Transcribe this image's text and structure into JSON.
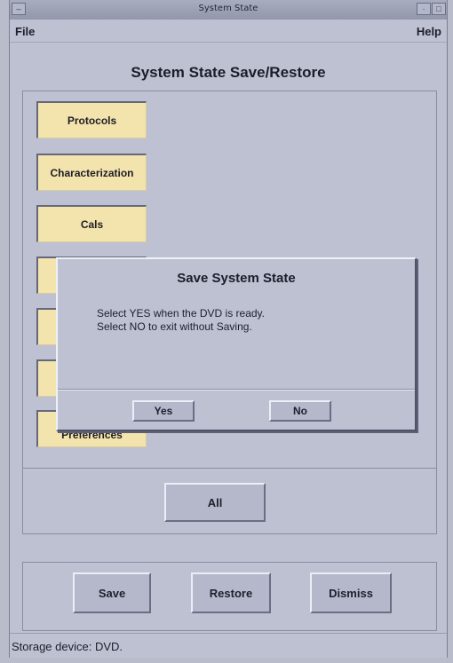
{
  "window": {
    "title": "System State"
  },
  "menu": {
    "file": "File",
    "help": "Help"
  },
  "heading": "System State Save/Restore",
  "categories": [
    {
      "label": "Protocols"
    },
    {
      "label": "Characterization"
    },
    {
      "label": "Cals"
    },
    {
      "label": ""
    },
    {
      "label": ""
    },
    {
      "label": ""
    },
    {
      "label": "Preferences"
    }
  ],
  "all_button": "All",
  "actions": {
    "save": "Save",
    "restore": "Restore",
    "dismiss": "Dismiss"
  },
  "status": "Storage device: DVD.",
  "dialog": {
    "title": "Save System State",
    "line1": "Select YES when the DVD is ready.",
    "line2": "Select NO to exit without Saving.",
    "yes": "Yes",
    "no": "No"
  },
  "colors": {
    "category_button": "#f3e3ad",
    "window_background": "#bec1d2"
  }
}
